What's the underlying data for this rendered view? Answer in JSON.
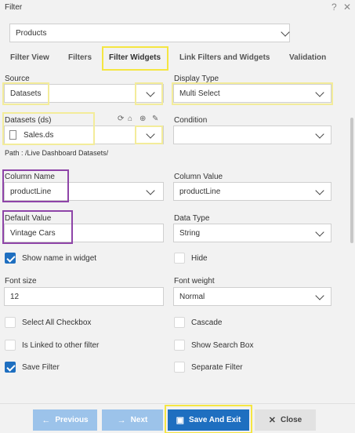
{
  "window": {
    "title": "Filter",
    "help_icon": "question-icon",
    "close_icon": "close-icon"
  },
  "widget_select": {
    "value": "Products"
  },
  "tabs": [
    {
      "label": "Filter View"
    },
    {
      "label": "Filters"
    },
    {
      "label": "Filter Widgets"
    },
    {
      "label": "Link Filters and Widgets"
    },
    {
      "label": "Validation"
    }
  ],
  "form": {
    "source": {
      "label": "Source",
      "value": "Datasets"
    },
    "display_type": {
      "label": "Display Type",
      "value": "Multi Select"
    },
    "datasets": {
      "label": "Datasets (ds)",
      "value": "Sales.ds",
      "icons": [
        "refresh-icon",
        "home-icon",
        "add-circle-icon",
        "edit-icon"
      ]
    },
    "condition": {
      "label": "Condition",
      "value": ""
    },
    "path": "Path : /Live Dashboard Datasets/",
    "column_name": {
      "label": "Column Name",
      "value": "productLine"
    },
    "column_value": {
      "label": "Column Value",
      "value": "productLine"
    },
    "default_value": {
      "label": "Default Value",
      "value": "Vintage Cars"
    },
    "data_type": {
      "label": "Data Type",
      "value": "String"
    },
    "show_name": {
      "label": "Show name in widget",
      "checked": true
    },
    "hide": {
      "label": "Hide",
      "checked": false
    },
    "font_size": {
      "label": "Font size",
      "value": "12"
    },
    "font_weight": {
      "label": "Font weight",
      "value": "Normal"
    },
    "select_all": {
      "label": "Select All Checkbox",
      "checked": false
    },
    "cascade": {
      "label": "Cascade",
      "checked": false
    },
    "linked": {
      "label": "Is Linked to other filter",
      "checked": false
    },
    "show_search": {
      "label": "Show Search Box",
      "checked": false
    },
    "save_filter": {
      "label": "Save Filter",
      "checked": true
    },
    "separate_filter": {
      "label": "Separate Filter",
      "checked": false
    }
  },
  "footer": {
    "previous": "Previous",
    "next": "Next",
    "save_exit": "Save And Exit",
    "close": "Close"
  },
  "colors": {
    "accent": "#1e6fc0",
    "disabled_button": "#9cc3ea",
    "highlight_yellow": "#f5e642",
    "highlight_purple": "#8e44a8"
  }
}
